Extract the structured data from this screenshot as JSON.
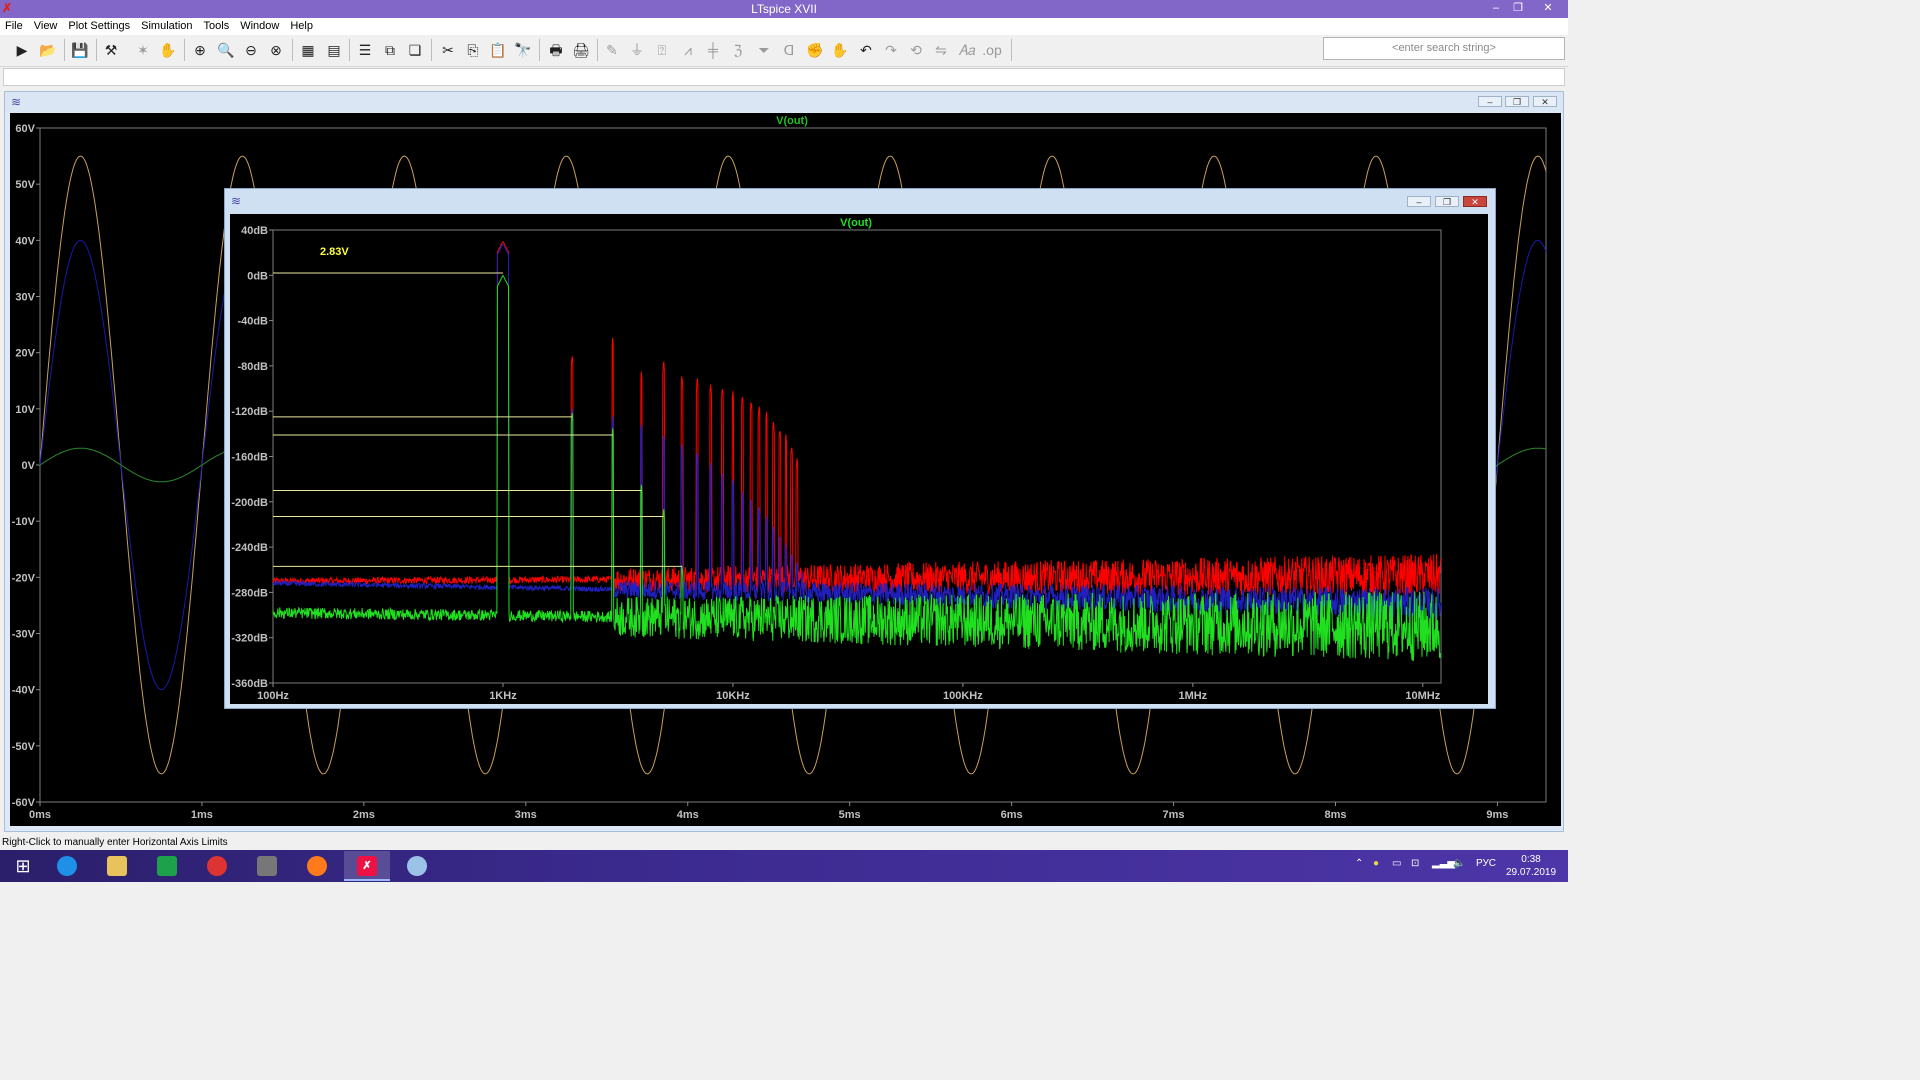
{
  "app": {
    "title": "LTspice XVII"
  },
  "menu": [
    "File",
    "View",
    "Plot Settings",
    "Simulation",
    "Tools",
    "Window",
    "Help"
  ],
  "toolbar_icons": [
    "run-icon",
    "open-icon",
    "save-icon",
    "control-panel-icon",
    "halt-icon",
    "pan-icon",
    "zoom-in-icon",
    "zoom-box-icon",
    "zoom-out-icon",
    "zoom-cancel-icon",
    "autorange-icon",
    "split-icon",
    "tile-horizontal-icon",
    "tile-vertical-icon",
    "cascade-icon",
    "cut-icon",
    "copy-icon",
    "paste-icon",
    "find-icon",
    "print-icon",
    "print-setup-icon",
    "wire-icon",
    "ground-icon",
    "label-icon",
    "resistor-icon",
    "capacitor-icon",
    "inductor-icon",
    "diode-icon",
    "component-icon",
    "move-icon",
    "drag-icon",
    "undo-icon",
    "redo-icon",
    "rotate-icon",
    "mirror-icon",
    "text-icon",
    "spice-directive-icon"
  ],
  "search": {
    "placeholder": "<enter search string>"
  },
  "waveform_window": {
    "trace_label": "V(out)",
    "y_ticks": [
      "60V",
      "50V",
      "40V",
      "30V",
      "20V",
      "10V",
      "0V",
      "-10V",
      "-20V",
      "-30V",
      "-40V",
      "-50V",
      "-60V"
    ],
    "x_ticks": [
      "0ms",
      "1ms",
      "2ms",
      "3ms",
      "4ms",
      "5ms",
      "6ms",
      "7ms",
      "8ms",
      "9ms"
    ]
  },
  "fft_window": {
    "trace_label": "V(out)",
    "cursor_label": "2.83V",
    "y_ticks": [
      "40dB",
      "0dB",
      "-40dB",
      "-80dB",
      "-120dB",
      "-160dB",
      "-200dB",
      "-240dB",
      "-280dB",
      "-320dB",
      "-360dB"
    ],
    "x_ticks": [
      "100Hz",
      "1KHz",
      "10KHz",
      "100KHz",
      "1MHz",
      "10MHz"
    ]
  },
  "chart_data": [
    {
      "type": "line",
      "title": "V(out)",
      "xlabel": "",
      "ylabel": "",
      "xlim": [
        0,
        9.3
      ],
      "x_unit": "ms",
      "ylim": [
        -60,
        60
      ],
      "y_unit": "V",
      "grid": false,
      "series": [
        {
          "color": "#c8a05a",
          "frequency_khz": 1,
          "amplitude": 55,
          "phase": 0
        },
        {
          "color": "#1a1aa8",
          "frequency_khz": 1,
          "amplitude": 40,
          "phase": 0
        },
        {
          "color": "#2a8a2a",
          "frequency_khz": 1,
          "amplitude": 3,
          "phase": 0
        }
      ]
    },
    {
      "type": "line",
      "title": "V(out)",
      "xlabel": "",
      "ylabel": "",
      "x_scale": "log",
      "xlim": [
        100,
        12000000
      ],
      "x_unit": "Hz",
      "ylim": [
        -360,
        40
      ],
      "y_unit": "dB",
      "grid": false,
      "series": [
        {
          "color": "#ff0000",
          "fundamental_hz": 1000,
          "fundamental_db": 30,
          "harmonic_peaks_db": [
            30,
            -70,
            -55,
            -85,
            -75,
            -88,
            -90,
            -95,
            -98,
            -102,
            -105,
            -110,
            -115,
            -120,
            -128,
            -135,
            -140,
            -150,
            -160
          ],
          "noise_floor_db_at_low": -270,
          "noise_floor_db_at_high": -265
        },
        {
          "color": "#2020c0",
          "fundamental_hz": 1000,
          "fundamental_db": 28,
          "noise_floor_db_at_low": -272,
          "noise_floor_db_at_high": -290
        },
        {
          "color": "#20e020",
          "fundamental_hz": 1000,
          "fundamental_db": 0,
          "harmonic_peaks_db": [
            0,
            -120,
            -135,
            -185,
            -205,
            -255
          ],
          "noise_floor_db_at_low": -298,
          "noise_floor_db_at_high": -310
        }
      ],
      "cursor_lines_db": [
        2,
        -125,
        -141,
        -190,
        -213,
        -257
      ]
    }
  ],
  "status": {
    "text": "Right-Click to manually enter Horizontal Axis Limits"
  },
  "tray": {
    "lang": "РУС",
    "time": "0:38",
    "date": "29.07.2019"
  }
}
